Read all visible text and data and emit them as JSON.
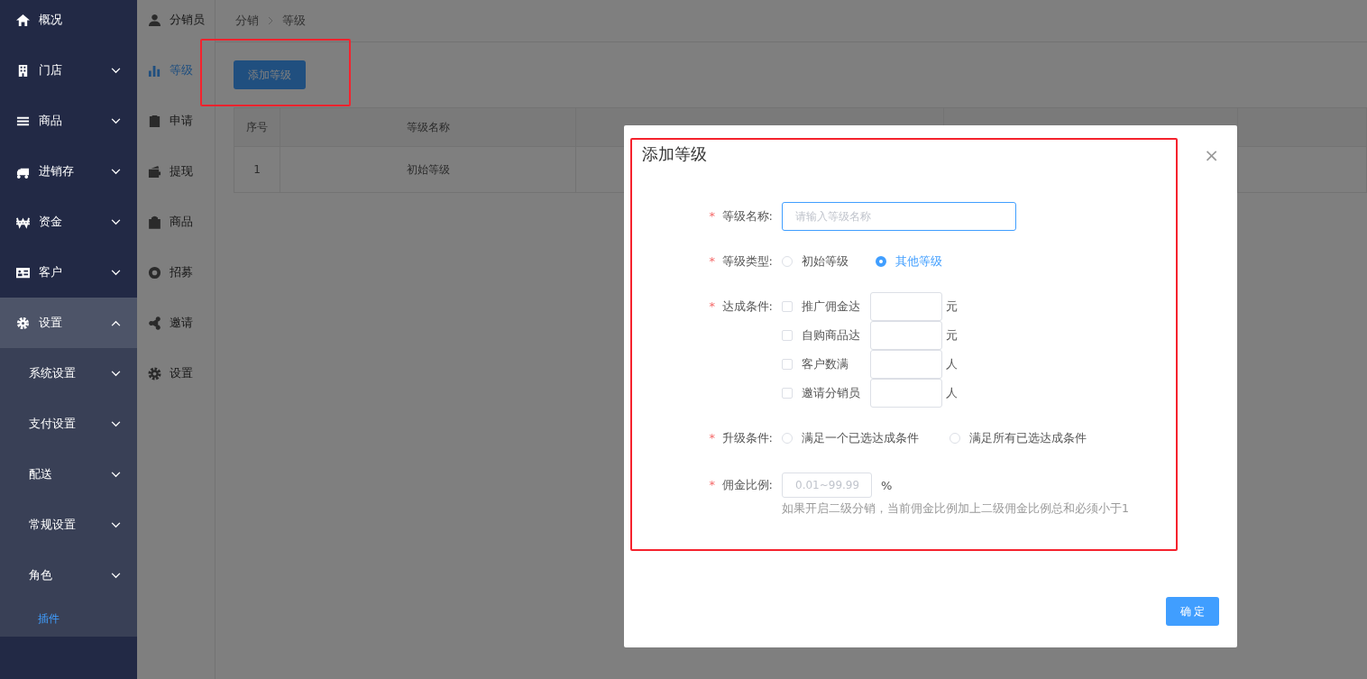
{
  "sidebar": {
    "items": [
      {
        "label": "概况"
      },
      {
        "label": "门店",
        "expanded": false
      },
      {
        "label": "商品",
        "expanded": false
      },
      {
        "label": "进销存",
        "expanded": false
      },
      {
        "label": "资金",
        "expanded": false
      },
      {
        "label": "客户",
        "expanded": false
      },
      {
        "label": "设置",
        "expanded": true,
        "children": [
          {
            "label": "系统设置",
            "selected": false,
            "expanded": false
          },
          {
            "label": "支付设置",
            "selected": false,
            "expanded": false
          },
          {
            "label": "配送",
            "selected": false,
            "expanded": false
          },
          {
            "label": "常规设置",
            "selected": false,
            "expanded": false
          },
          {
            "label": "角色",
            "selected": false,
            "expanded": false
          },
          {
            "label": "插件",
            "selected": true
          }
        ]
      }
    ]
  },
  "subnav": {
    "items": [
      {
        "label": "分销员",
        "selected": false
      },
      {
        "label": "等级",
        "selected": true
      },
      {
        "label": "申请",
        "selected": false
      },
      {
        "label": "提现",
        "selected": false
      },
      {
        "label": "商品",
        "selected": false
      },
      {
        "label": "招募",
        "selected": false
      },
      {
        "label": "邀请",
        "selected": false
      },
      {
        "label": "设置",
        "selected": false
      }
    ]
  },
  "breadcrumb": [
    "分销",
    "等级"
  ],
  "add_button": "添加等级",
  "table": {
    "columns": [
      "序号",
      "等级名称"
    ],
    "rows": [
      [
        "1",
        "初始等级"
      ]
    ]
  },
  "modal": {
    "title": "添加等级",
    "close": "×",
    "name_field": {
      "required": "*",
      "label": "等级名称:",
      "placeholder": "请输入等级名称"
    },
    "type_field": {
      "required": "*",
      "label": "等级类型:",
      "options": [
        {
          "label": "初始等级",
          "selected": false
        },
        {
          "label": "其他等级",
          "selected": true
        }
      ]
    },
    "conditions": {
      "required": "*",
      "label": "达成条件:",
      "items": [
        {
          "label": "推广佣金达",
          "checked": false,
          "unit": "元"
        },
        {
          "label": "自购商品达",
          "checked": false,
          "unit": "元"
        },
        {
          "label": "客户数满",
          "checked": false,
          "unit": "人"
        },
        {
          "label": "邀请分销员",
          "checked": false,
          "unit": "人"
        }
      ]
    },
    "upgrade_field": {
      "required": "*",
      "label": "升级条件:",
      "options": [
        {
          "label": "满足一个已选达成条件",
          "selected": false
        },
        {
          "label": "满足所有已选达成条件",
          "selected": false
        }
      ]
    },
    "ratio_field": {
      "required": "*",
      "label": "佣金比例:",
      "placeholder": "0.01~99.99",
      "unit": "%",
      "hint": "如果开启二级分销，当前佣金比例加上二级佣金比例总和必须小于1"
    },
    "confirm": "确 定"
  }
}
